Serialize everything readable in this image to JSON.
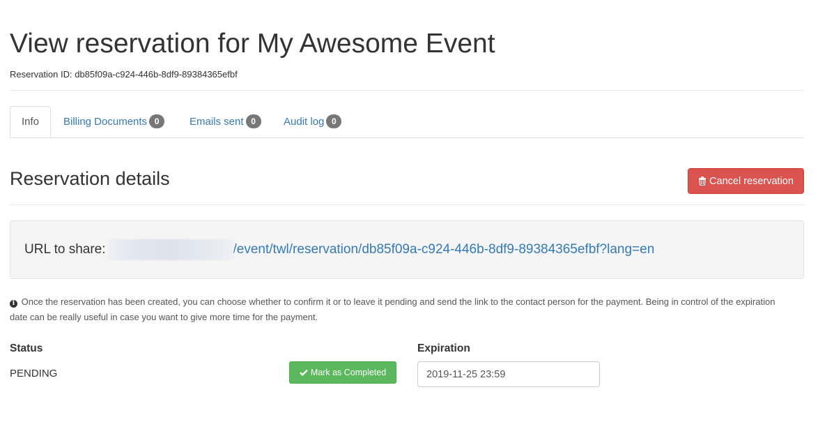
{
  "page": {
    "title": "View reservation for My Awesome Event",
    "reservation_id_label": "Reservation ID:",
    "reservation_id": "db85f09a-c924-446b-8df9-89384365efbf"
  },
  "tabs": [
    {
      "label": "Info",
      "count": null,
      "active": true
    },
    {
      "label": "Billing Documents",
      "count": "0",
      "active": false
    },
    {
      "label": "Emails sent",
      "count": "0",
      "active": false
    },
    {
      "label": "Audit log",
      "count": "0",
      "active": false
    }
  ],
  "details": {
    "title": "Reservation details",
    "cancel_label": "Cancel reservation",
    "cancel_icon": "trash-icon",
    "share_label": "URL to share:",
    "share_path": "/event/twl/reservation/db85f09a-c924-446b-8df9-89384365efbf?lang=en",
    "info_icon": "info-circle-icon",
    "info_text": "Once the reservation has been created, you can choose whether to confirm it or to leave it pending and send the link to the contact person for the payment. Being in control of the expiration date can be really useful in case you want to give more time for the payment.",
    "status_label": "Status",
    "status_value": "PENDING",
    "complete_label": "Mark as Completed",
    "complete_icon": "check-icon",
    "expiration_label": "Expiration",
    "expiration_value": "2019-11-25 23:59"
  },
  "colors": {
    "link": "#337ab7",
    "danger": "#d9534f",
    "success": "#5cb85c",
    "badge": "#777777",
    "well": "#f5f5f5"
  }
}
